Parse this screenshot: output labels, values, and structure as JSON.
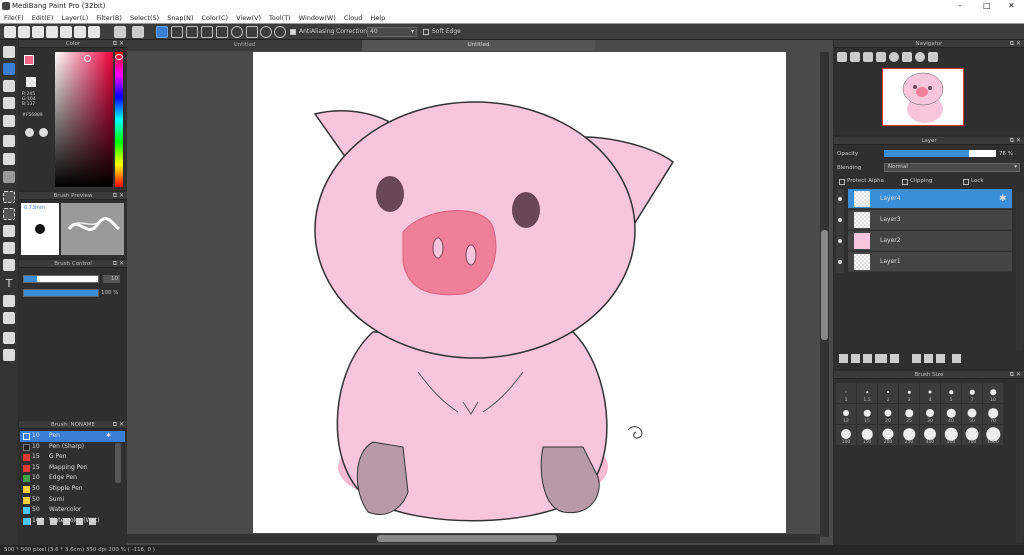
{
  "app": {
    "title": "MediBang Paint Pro (32bit)",
    "window_controls": [
      "–",
      "□",
      "✕"
    ]
  },
  "menu": [
    "File(F)",
    "Edit(E)",
    "Layer(L)",
    "Filter(B)",
    "Select(S)",
    "Snap(N)",
    "Color(C)",
    "View(V)",
    "Tool(T)",
    "Window(W)",
    "Cloud",
    "Help"
  ],
  "toolbar": {
    "antialias_label": "AntiAliasing",
    "correction_label": "Correction",
    "correction_value": "40",
    "soft_edge_label": "Soft Edge"
  },
  "color_panel": {
    "title": "Color",
    "r": "R:245",
    "g": "G:104",
    "b": "B:137",
    "hex": "#F56889",
    "fg_color": "#f56889"
  },
  "brush_preview": {
    "title": "Brush Preview",
    "size": "0.73mm"
  },
  "brush_control": {
    "title": "Brush Control",
    "size_value": "10",
    "opacity_value": "100 %"
  },
  "brush_list": {
    "title": "Brush: NONAME",
    "items": [
      {
        "size": "10",
        "name": "Pen",
        "color": "#2a7fc8",
        "selected": true
      },
      {
        "size": "10",
        "name": "Pen (Sharp)",
        "color": "#222222"
      },
      {
        "size": "15",
        "name": "G Pen",
        "color": "#e53935"
      },
      {
        "size": "15",
        "name": "Mapping Pen",
        "color": "#e53935"
      },
      {
        "size": "10",
        "name": "Edge Pen",
        "color": "#43a047"
      },
      {
        "size": "50",
        "name": "Stipple Pen",
        "color": "#f4d03f"
      },
      {
        "size": "50",
        "name": "Sumi",
        "color": "#f4d03f"
      },
      {
        "size": "50",
        "name": "Watercolor",
        "color": "#4fc3f7"
      },
      {
        "size": "100",
        "name": "Watercolor (Wet)",
        "color": "#4fc3f7"
      }
    ]
  },
  "canvas": {
    "tab_left": "Untitled",
    "tab_main": "Untitled"
  },
  "navigator": {
    "title": "Navigator"
  },
  "layer_panel": {
    "title": "Layer",
    "opacity_label": "Opacity",
    "opacity_value": "76 %",
    "opacity_fraction": 0.76,
    "blending_label": "Blending",
    "blending_value": "Normal",
    "protect_alpha_label": "Protect Alpha",
    "clipping_label": "Clipping",
    "lock_label": "Lock",
    "layers": [
      {
        "name": "Layer4",
        "selected": true
      },
      {
        "name": "Layer3",
        "selected": false
      },
      {
        "name": "Layer2",
        "selected": false
      },
      {
        "name": "Layer1",
        "selected": false
      }
    ]
  },
  "brush_size_panel": {
    "title": "Brush Size",
    "sizes": [
      "1",
      "1.5",
      "2",
      "3",
      "4",
      "5",
      "7",
      "10",
      "12",
      "15",
      "20",
      "25",
      "30",
      "40",
      "50",
      "70",
      "100",
      "150",
      "200",
      "250",
      "400",
      "500",
      "700",
      "1000"
    ]
  },
  "status": {
    "text": "500 * 500 pixel  (3.6 * 3.6cm)  350 dpi  200 %  ( -116, 0 )"
  }
}
